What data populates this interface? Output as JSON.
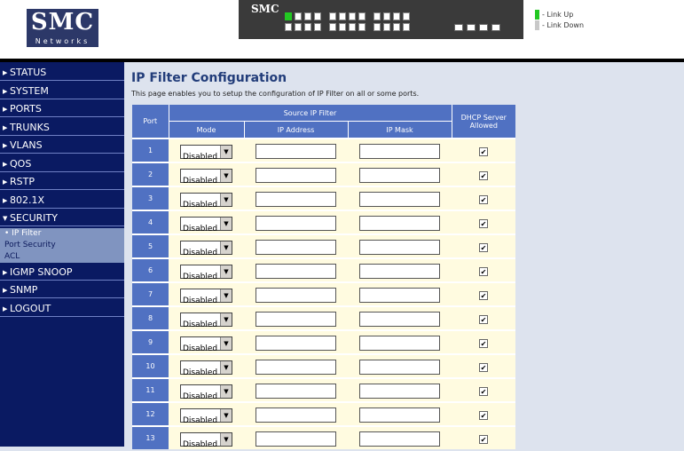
{
  "header": {
    "logo_text": "SMC",
    "logo_subtext": "Networks",
    "switch_brand": "SMC",
    "legend": [
      {
        "label": "- Link Up",
        "color": "#22c822"
      },
      {
        "label": "- Link Down",
        "color": "#c8c8c8"
      }
    ]
  },
  "sidebar": {
    "items": [
      {
        "label": "STATUS",
        "expanded": false
      },
      {
        "label": "SYSTEM",
        "expanded": false
      },
      {
        "label": "PORTS",
        "expanded": false
      },
      {
        "label": "TRUNKS",
        "expanded": false
      },
      {
        "label": "VLANS",
        "expanded": false
      },
      {
        "label": "QOS",
        "expanded": false
      },
      {
        "label": "RSTP",
        "expanded": false
      },
      {
        "label": "802.1X",
        "expanded": false
      },
      {
        "label": "SECURITY",
        "expanded": true
      },
      {
        "label": "IGMP SNOOP",
        "expanded": false
      },
      {
        "label": "SNMP",
        "expanded": false
      },
      {
        "label": "LOGOUT",
        "expanded": false
      }
    ],
    "security_subitems": [
      {
        "label": "IP Filter",
        "active": true
      },
      {
        "label": "Port Security",
        "active": false
      },
      {
        "label": "ACL",
        "active": false
      }
    ]
  },
  "main": {
    "title": "IP Filter Configuration",
    "description": "This page enables you to setup the configuration of IP Filter on all or some ports."
  },
  "table": {
    "headers": {
      "port": "Port",
      "source_group": "Source IP Filter",
      "mode": "Mode",
      "ip_address": "IP Address",
      "ip_mask": "IP Mask",
      "dhcp": "DHCP Server Allowed"
    },
    "rows": [
      {
        "port": "1",
        "mode": "Disabled",
        "dhcp_allowed": true
      },
      {
        "port": "2",
        "mode": "Disabled",
        "dhcp_allowed": true
      },
      {
        "port": "3",
        "mode": "Disabled",
        "dhcp_allowed": true
      },
      {
        "port": "4",
        "mode": "Disabled",
        "dhcp_allowed": true
      },
      {
        "port": "5",
        "mode": "Disabled",
        "dhcp_allowed": true
      },
      {
        "port": "6",
        "mode": "Disabled",
        "dhcp_allowed": true
      },
      {
        "port": "7",
        "mode": "Disabled",
        "dhcp_allowed": true
      },
      {
        "port": "8",
        "mode": "Disabled",
        "dhcp_allowed": true
      },
      {
        "port": "9",
        "mode": "Disabled",
        "dhcp_allowed": true
      },
      {
        "port": "10",
        "mode": "Disabled",
        "dhcp_allowed": true
      },
      {
        "port": "11",
        "mode": "Disabled",
        "dhcp_allowed": true
      },
      {
        "port": "12",
        "mode": "Disabled",
        "dhcp_allowed": true
      },
      {
        "port": "13",
        "mode": "Disabled",
        "dhcp_allowed": true
      }
    ]
  },
  "colors": {
    "sidebar_bg": "#0a1a62",
    "submenu_bg": "#8094c0",
    "table_header_bg": "#5071c2",
    "row_bg": "#fffbe0",
    "title_color": "#223d7a"
  }
}
